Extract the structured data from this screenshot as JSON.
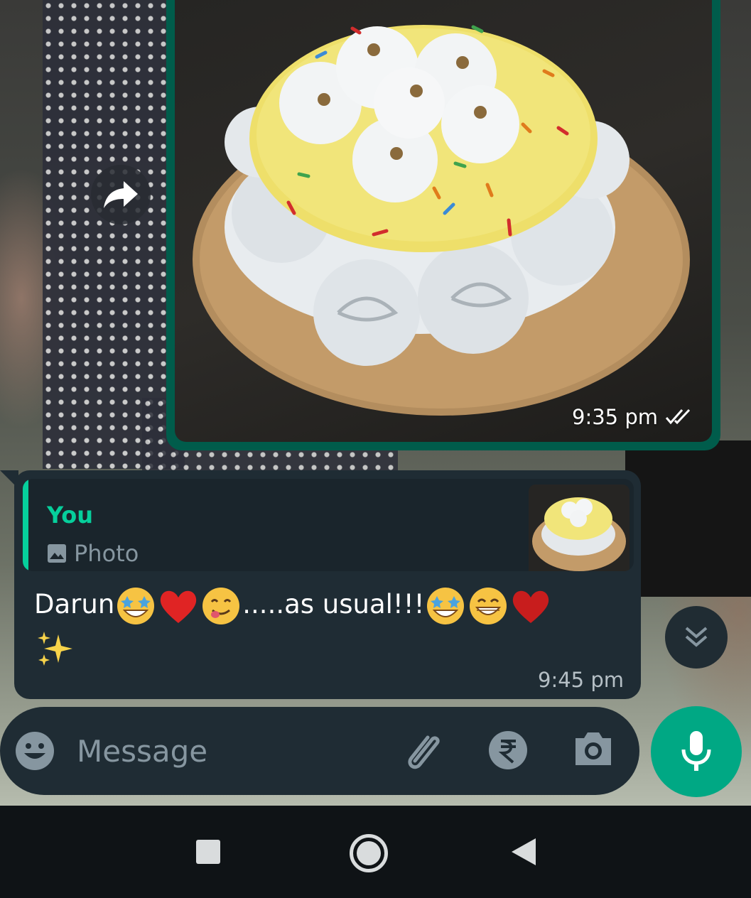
{
  "image_message": {
    "time": "9:35 pm",
    "status_icon": "double-tick-read-icon",
    "forward_icon": "forward-arrow-icon"
  },
  "reply_message": {
    "quoted_author": "You",
    "quoted_type": "Photo",
    "quoted_type_icon": "photo-icon",
    "text_part1": "Darun",
    "text_part2": ".....as usual!!!",
    "emojis": [
      "star-struck",
      "red-heart",
      "face-savoring-food",
      "star-struck",
      "beaming-face",
      "red-heart",
      "sparkles"
    ],
    "time": "9:45 pm"
  },
  "scroll_button_icon": "double-chevron-down-icon",
  "composer": {
    "placeholder": "Message",
    "icons": [
      "emoji-icon",
      "attach-icon",
      "rupee-icon",
      "camera-icon"
    ],
    "mic_icon": "mic-icon"
  },
  "navbar": {
    "icons": [
      "recent-apps-icon",
      "home-icon",
      "back-icon"
    ]
  },
  "colors": {
    "accent": "#06cf9c",
    "outgoing_bubble": "#005c4b",
    "incoming_bubble": "#1f2c34",
    "mic_button": "#00a884"
  }
}
